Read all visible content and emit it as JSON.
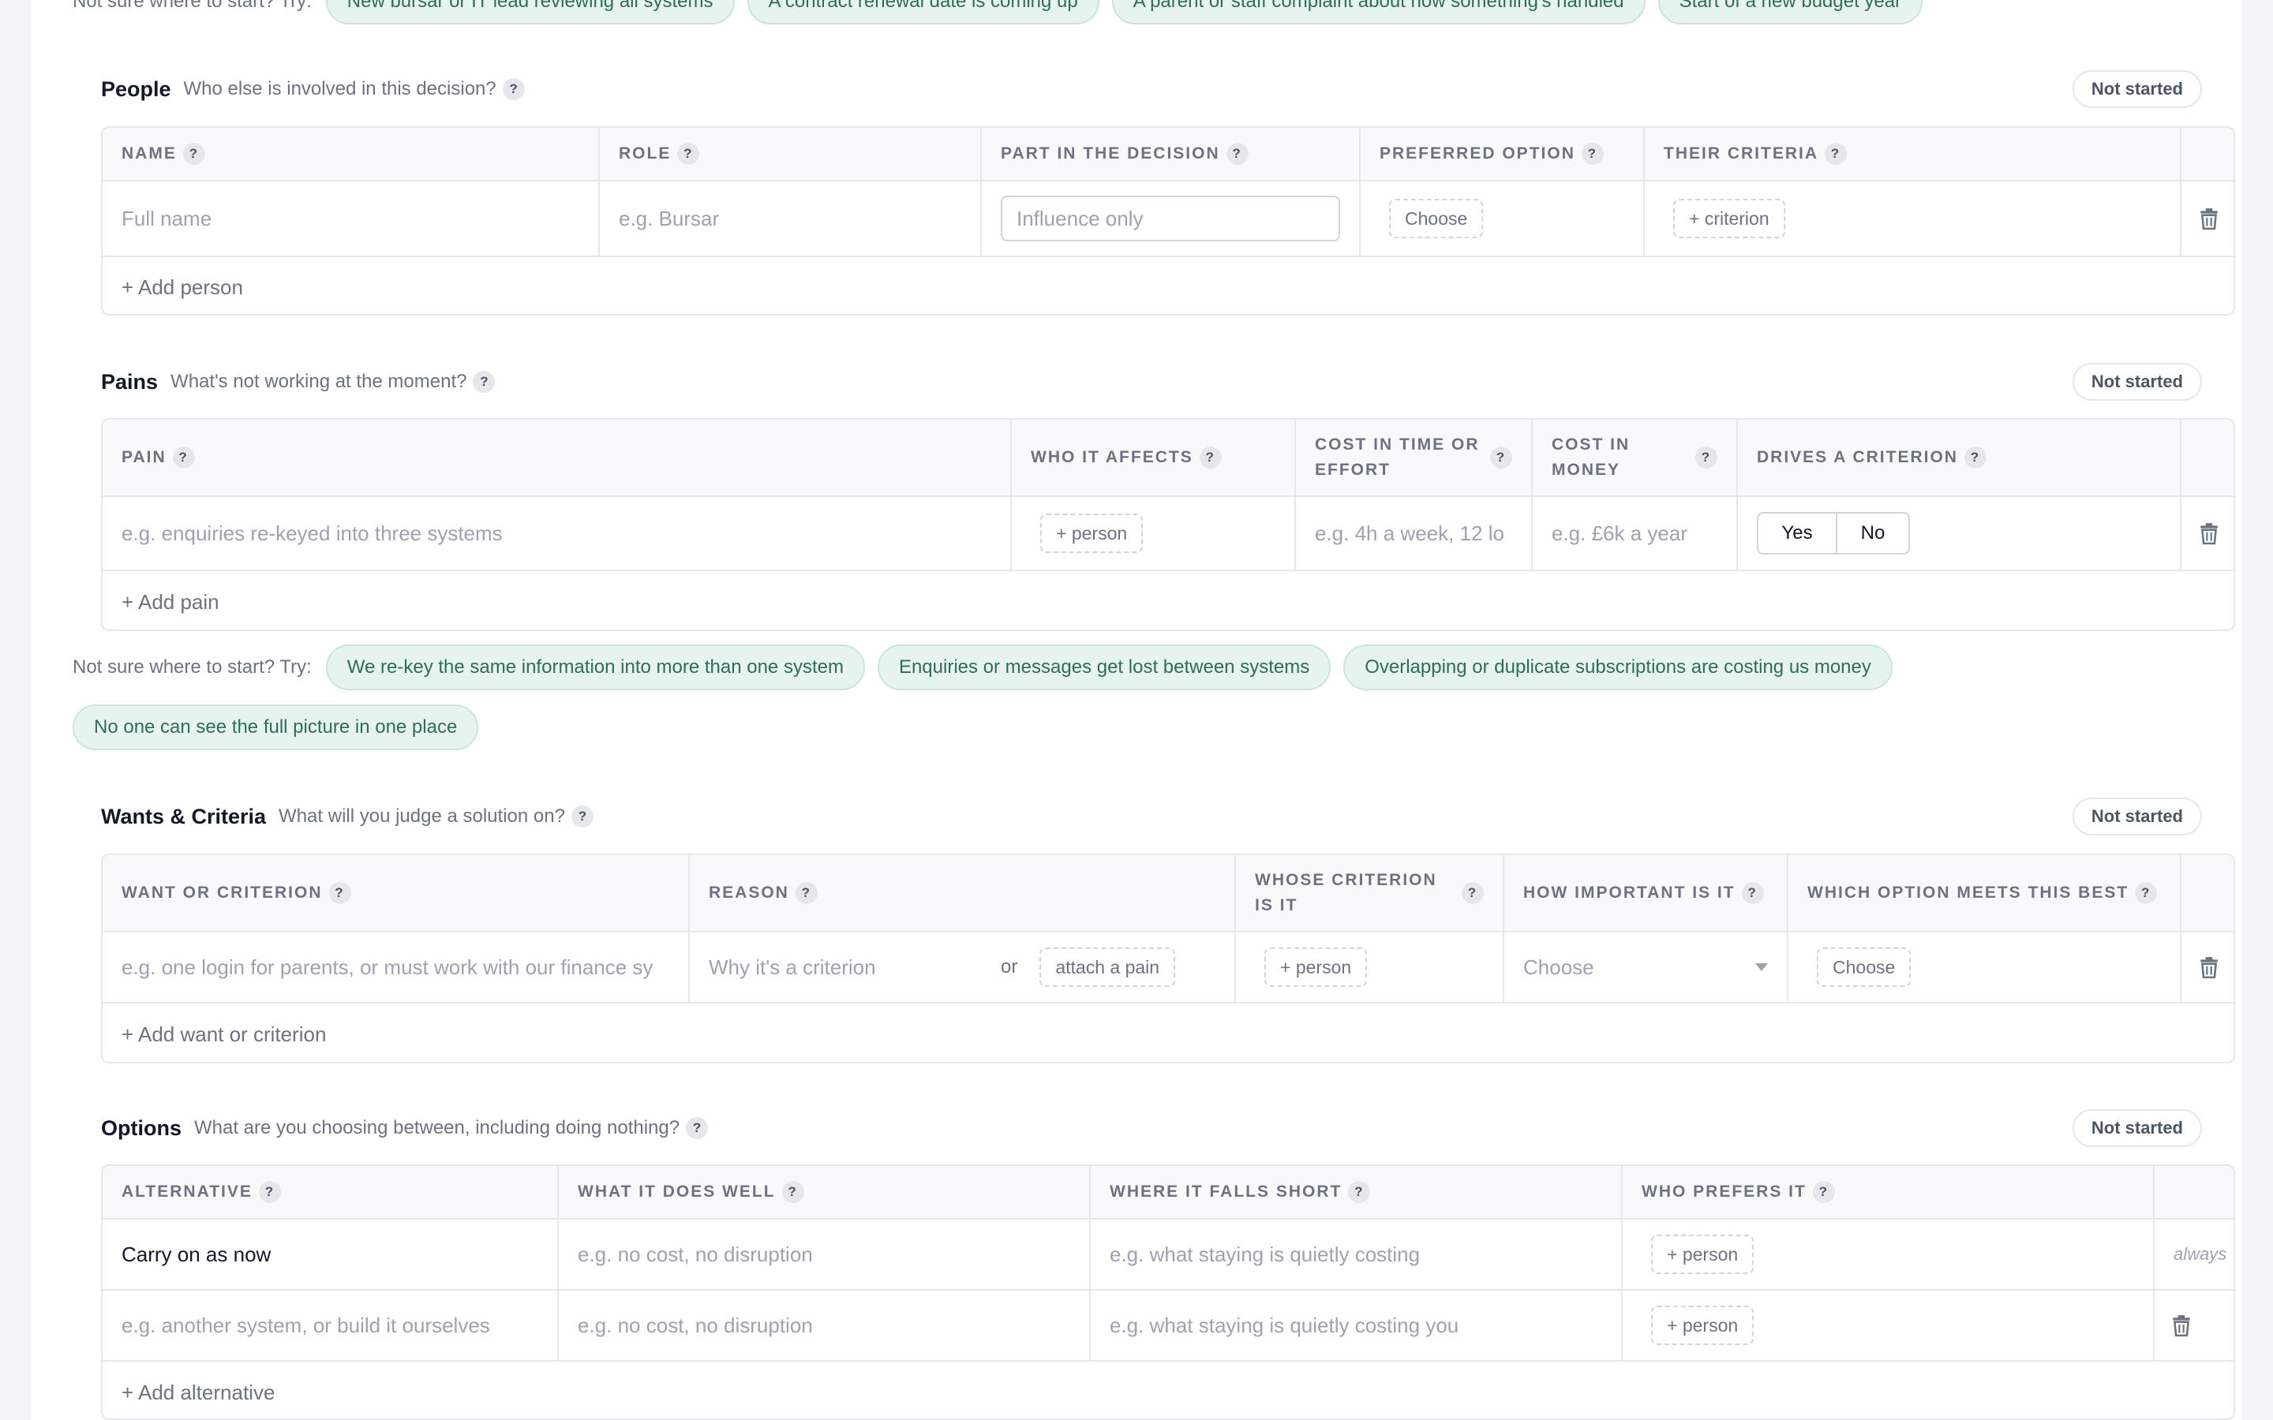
{
  "try_label": "Not sure where to start? Try:",
  "top_try": {
    "chips": [
      "New bursar or IT lead reviewing all systems",
      "A contract renewal date is coming up",
      "A parent or staff complaint about how something's handled",
      "Start of a new budget year"
    ]
  },
  "help_glyph": "?",
  "trash_icon": "trash-icon",
  "people": {
    "title": "People",
    "question": "Who else is involved in this decision?",
    "status": "Not started",
    "columns": [
      "NAME",
      "ROLE",
      "PART IN THE DECISION",
      "PREFERRED OPTION",
      "THEIR CRITERIA"
    ],
    "row": {
      "name_placeholder": "Full name",
      "role_placeholder": "e.g. Bursar",
      "part_value": "Influence only",
      "preferred_button": "Choose",
      "criteria_button": "+ criterion"
    },
    "add_label": "+ Add person"
  },
  "pains": {
    "title": "Pains",
    "question": "What's not working at the moment?",
    "status": "Not started",
    "columns": [
      "PAIN",
      "WHO IT AFFECTS",
      "COST IN TIME OR EFFORT",
      "COST IN MONEY",
      "DRIVES A CRITERION"
    ],
    "row": {
      "pain_placeholder": "e.g. enquiries re-keyed into three systems",
      "affects_button": "+ person",
      "time_placeholder": "e.g. 4h a week, 12 lo",
      "money_placeholder": "e.g. £6k a year",
      "yes": "Yes",
      "no": "No"
    },
    "add_label": "+ Add pain",
    "try_chips": [
      "We re-key the same information into more than one system",
      "Enquiries or messages get lost between systems",
      "Overlapping or duplicate subscriptions are costing us money",
      "No one can see the full picture in one place"
    ]
  },
  "wants": {
    "title": "Wants & Criteria",
    "question": "What will you judge a solution on?",
    "status": "Not started",
    "columns": [
      "WANT OR CRITERION",
      "REASON",
      "WHOSE CRITERION IS IT",
      "HOW IMPORTANT IS IT",
      "WHICH OPTION MEETS THIS BEST"
    ],
    "row": {
      "want_placeholder": "e.g. one login for parents, or must work with our finance sy",
      "reason_placeholder": "Why it's a criterion",
      "or_text": "or",
      "attach_button": "attach a pain",
      "whose_button": "+ person",
      "importance_value": "Choose",
      "option_button": "Choose"
    },
    "add_label": "+ Add want or criterion"
  },
  "options": {
    "title": "Options",
    "question": "What are you choosing between, including doing nothing?",
    "status": "Not started",
    "columns": [
      "ALTERNATIVE",
      "WHAT IT DOES WELL",
      "WHERE IT FALLS SHORT",
      "WHO PREFERS IT"
    ],
    "rows": [
      {
        "alternative": "Carry on as now",
        "does_well": "e.g. no cost, no disruption",
        "falls_short": "e.g. what staying is quietly costing",
        "prefers_button": "+ person",
        "end": "always"
      },
      {
        "alternative": "e.g. another system, or build it ourselves",
        "does_well": "e.g. no cost, no disruption",
        "falls_short": "e.g. what staying is quietly costing you",
        "prefers_button": "+ person"
      }
    ],
    "add_label": "+ Add alternative"
  }
}
